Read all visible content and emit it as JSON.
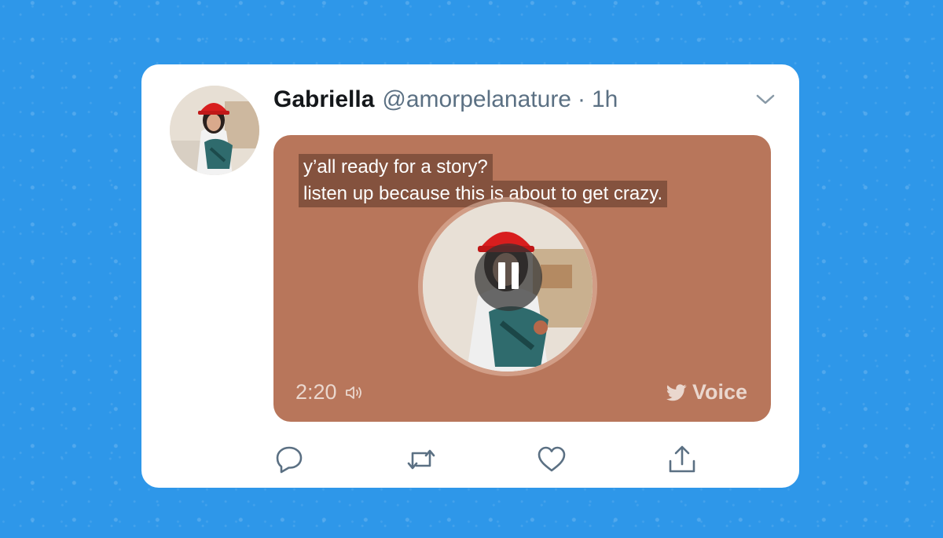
{
  "tweet": {
    "author_name": "Gabriella",
    "handle": "@amorpelanature",
    "separator": "·",
    "time": "1h"
  },
  "voice": {
    "caption_lines": [
      "y’all ready for a story?",
      "listen up because this is about to get crazy."
    ],
    "duration": "2:20",
    "brand_label": "Voice",
    "state": "playing"
  },
  "icons": {
    "menu": "chevron-down-icon",
    "sound": "speaker-icon",
    "brand": "bird-icon",
    "pause": "pause-icon",
    "reply": "reply-icon",
    "retweet": "retweet-icon",
    "like": "heart-icon",
    "share": "share-icon"
  },
  "colors": {
    "background": "#2e97e9",
    "card": "#ffffff",
    "media_background": "#b8765b",
    "muted_text": "#5b7083",
    "icon": "#5b7083"
  }
}
